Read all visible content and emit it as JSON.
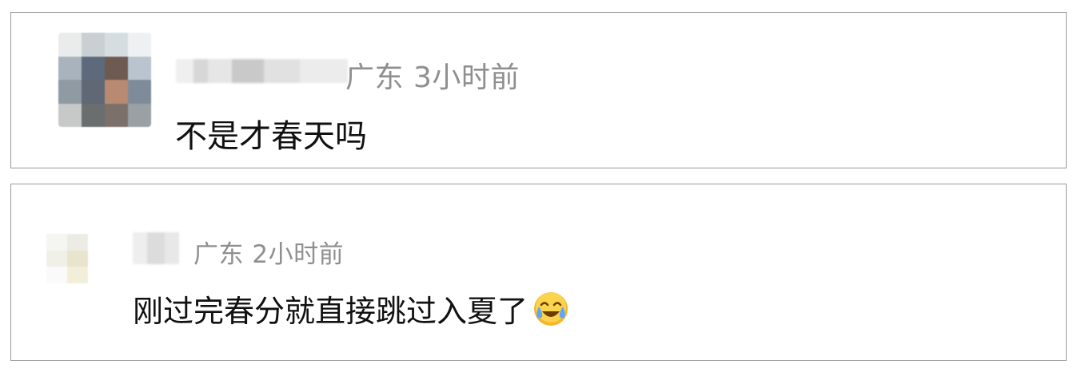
{
  "comments": [
    {
      "location": "广东",
      "time": "3小时前",
      "text": "不是才春天吗"
    },
    {
      "location": "广东",
      "time": "2小时前",
      "text": "刚过完春分就直接跳过入夏了",
      "emoji": "laughing-crying-emoji"
    }
  ],
  "colors": {
    "meta_text": "#8f8f8f",
    "comment_text": "#111111",
    "card_border": "#9a9a9a",
    "emoji_face": "#f5b62a"
  }
}
